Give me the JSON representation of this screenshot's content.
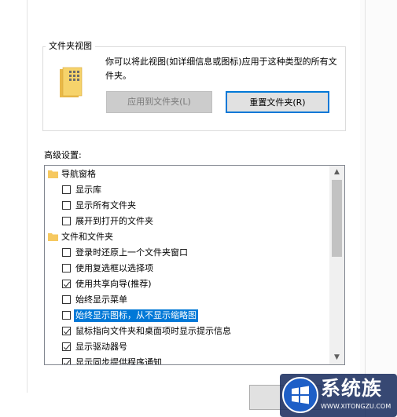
{
  "folder_view": {
    "title": "文件夹视图",
    "description": "你可以将此视图(如详细信息或图标)应用于这种类型的所有文件夹。",
    "apply_button": "应用到文件夹(L)",
    "reset_button": "重置文件夹(R)"
  },
  "advanced": {
    "label": "高级设置:",
    "items": [
      {
        "type": "group",
        "label": "导航窗格",
        "indent": 0
      },
      {
        "type": "check",
        "label": "显示库",
        "checked": false,
        "indent": 1
      },
      {
        "type": "check",
        "label": "显示所有文件夹",
        "checked": false,
        "indent": 1
      },
      {
        "type": "check",
        "label": "展开到打开的文件夹",
        "checked": false,
        "indent": 1
      },
      {
        "type": "group",
        "label": "文件和文件夹",
        "indent": 0
      },
      {
        "type": "check",
        "label": "登录时还原上一个文件夹窗口",
        "checked": false,
        "indent": 1
      },
      {
        "type": "check",
        "label": "使用复选框以选择项",
        "checked": false,
        "indent": 1
      },
      {
        "type": "check",
        "label": "使用共享向导(推荐)",
        "checked": true,
        "indent": 1
      },
      {
        "type": "check",
        "label": "始终显示菜单",
        "checked": false,
        "indent": 1
      },
      {
        "type": "check",
        "label": "始终显示图标，从不显示缩略图",
        "checked": false,
        "selected": true,
        "indent": 1
      },
      {
        "type": "check",
        "label": "鼠标指向文件夹和桌面项时显示提示信息",
        "checked": true,
        "indent": 1
      },
      {
        "type": "check",
        "label": "显示驱动器号",
        "checked": true,
        "indent": 1
      },
      {
        "type": "check",
        "label": "显示同步提供程序通知",
        "checked": true,
        "indent": 1
      }
    ]
  },
  "watermark": {
    "brand": "系统族",
    "url": "WWW.XITONGZU.COM"
  },
  "colors": {
    "accent": "#0078d7",
    "folder": "#f6c85f"
  }
}
